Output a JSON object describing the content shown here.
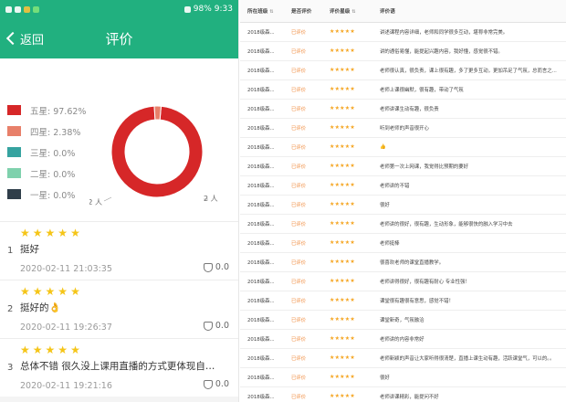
{
  "status_bar": {
    "battery": "98%",
    "time": "9:33"
  },
  "nav": {
    "back_label": "返回",
    "title": "评价"
  },
  "summary": {
    "legend": [
      {
        "label": "五星: 97.62%",
        "color": "#d62728"
      },
      {
        "label": "四星: 2.38%",
        "color": "#e8806a"
      },
      {
        "label": "三星: 0.0%",
        "color": "#36a3a0"
      },
      {
        "label": "二星: 0.0%",
        "color": "#7fd1ad"
      },
      {
        "label": "一星: 0.0%",
        "color": "#2f3e4a"
      }
    ],
    "donut_labels": {
      "five": "82 人",
      "four": "2 人"
    }
  },
  "chart_data": {
    "type": "pie",
    "categories": [
      "五星",
      "四星",
      "三星",
      "二星",
      "一星"
    ],
    "values": [
      82,
      2,
      0,
      0,
      0
    ],
    "percentages": [
      97.62,
      2.38,
      0.0,
      0.0,
      0.0
    ],
    "colors": [
      "#d62728",
      "#e8806a",
      "#36a3a0",
      "#7fd1ad",
      "#2f3e4a"
    ],
    "style": "donut",
    "legend": "left"
  },
  "reviews": [
    {
      "index": "1",
      "stars": 5,
      "text": "挺好",
      "date": "2020-02-11 21:03:35",
      "likes": "0.0"
    },
    {
      "index": "2",
      "stars": 5,
      "text": "挺好的👌",
      "date": "2020-02-11 19:26:37",
      "likes": "0.0"
    },
    {
      "index": "3",
      "stars": 5,
      "text": "总体不错 很久没上课用直播的方式更体现自身自觉...",
      "date": "2020-02-11 19:21:16",
      "likes": "0.0"
    }
  ],
  "table": {
    "headers": [
      "所在班级",
      "是否评价",
      "评价星级",
      "评价语"
    ],
    "rows": [
      [
        "2018级森...",
        "已评价",
        "★★★★★",
        "讲述课程内容详细，老师和同学很多互动，堪称非常完美。"
      ],
      [
        "2018级森...",
        "已评价",
        "★★★★★",
        "讲的通俗易懂，能提起兴趣内容，我好懂，感觉很不错。"
      ],
      [
        "2018级森...",
        "已评价",
        "★★★★★",
        "老师很认真，很负责，课上很有趣，多了更多互动，更加吊足了气氛，总而言之..."
      ],
      [
        "2018级森...",
        "已评价",
        "★★★★★",
        "老师上课很幽默，很有趣，带动了气氛"
      ],
      [
        "2018级森...",
        "已评价",
        "★★★★★",
        "老师讲课生动有趣，很负责"
      ],
      [
        "2018级森...",
        "已评价",
        "★★★★★",
        "听到老师的声音很开心"
      ],
      [
        "2018级森...",
        "已评价",
        "★★★★★",
        "👍"
      ],
      [
        "2018级森...",
        "已评价",
        "★★★★★",
        "老师第一次上网课，我觉得比预期的要好"
      ],
      [
        "2018级森...",
        "已评价",
        "★★★★★",
        "老师讲的不错"
      ],
      [
        "2018级森...",
        "已评价",
        "★★★★★",
        "很好"
      ],
      [
        "2018级森...",
        "已评价",
        "★★★★★",
        "老师讲的很好，很有趣，生动形象，能够很快的融入学习中去"
      ],
      [
        "2018级森...",
        "已评价",
        "★★★★★",
        "老师挺棒"
      ],
      [
        "2018级森...",
        "已评价",
        "★★★★★",
        "很喜欢老师的课堂直播教学。"
      ],
      [
        "2018级森...",
        "已评价",
        "★★★★★",
        "老师讲得很好，很有趣有耐心 专业性强！"
      ],
      [
        "2018级森...",
        "已评价",
        "★★★★★",
        "课堂很有趣很有意思，感觉不错！"
      ],
      [
        "2018级森...",
        "已评价",
        "★★★★★",
        "课堂新奇，气氛融洽"
      ],
      [
        "2018级森...",
        "已评价",
        "★★★★★",
        "老师讲的内容非常好"
      ],
      [
        "2018级森...",
        "已评价",
        "★★★★★",
        "老师新颖的声音让大家听得很清楚，直播上课生动有趣，活跃课堂气，可以的。。"
      ],
      [
        "2018级森...",
        "已评价",
        "★★★★★",
        "很好"
      ],
      [
        "2018级森...",
        "已评价",
        "★★★★★",
        "老师讲课精彩，能提问不好"
      ]
    ]
  }
}
